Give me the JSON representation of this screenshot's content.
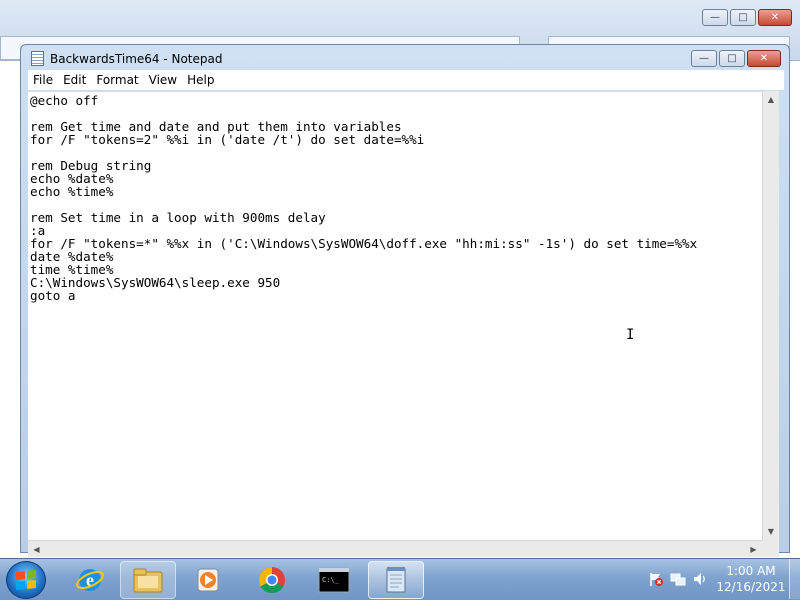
{
  "window": {
    "title": "BackwardsTime64 - Notepad",
    "minimize_glyph": "—",
    "maximize_glyph": "□",
    "close_glyph": "✕"
  },
  "menu": {
    "items": [
      "File",
      "Edit",
      "Format",
      "View",
      "Help"
    ]
  },
  "editor": {
    "content": "@echo off\n\nrem Get time and date and put them into variables\nfor /F \"tokens=2\" %%i in ('date /t') do set date=%%i\n\nrem Debug string\necho %date%\necho %time%\n\nrem Set time in a loop with 900ms delay\n:a\nfor /F \"tokens=*\" %%x in ('C:\\Windows\\SysWOW64\\doff.exe \"hh:mi:ss\" -1s') do set time=%%x\ndate %date%\ntime %time%\nC:\\Windows\\SysWOW64\\sleep.exe 950\ngoto a",
    "caret_glyph": "I"
  },
  "taskbar": {
    "icons": [
      "windows-start-icon",
      "internet-explorer-icon",
      "file-explorer-icon",
      "media-player-icon",
      "chrome-icon",
      "command-prompt-icon",
      "notepad-icon"
    ],
    "tray_icons": [
      "action-center-flag-icon",
      "network-icon",
      "volume-icon"
    ],
    "time": "1:00 AM",
    "date": "12/16/2021"
  },
  "colors": {
    "taskbar": "#7fa3cf",
    "title_bar": "#c9dbf0",
    "close_button": "#c74a35"
  }
}
